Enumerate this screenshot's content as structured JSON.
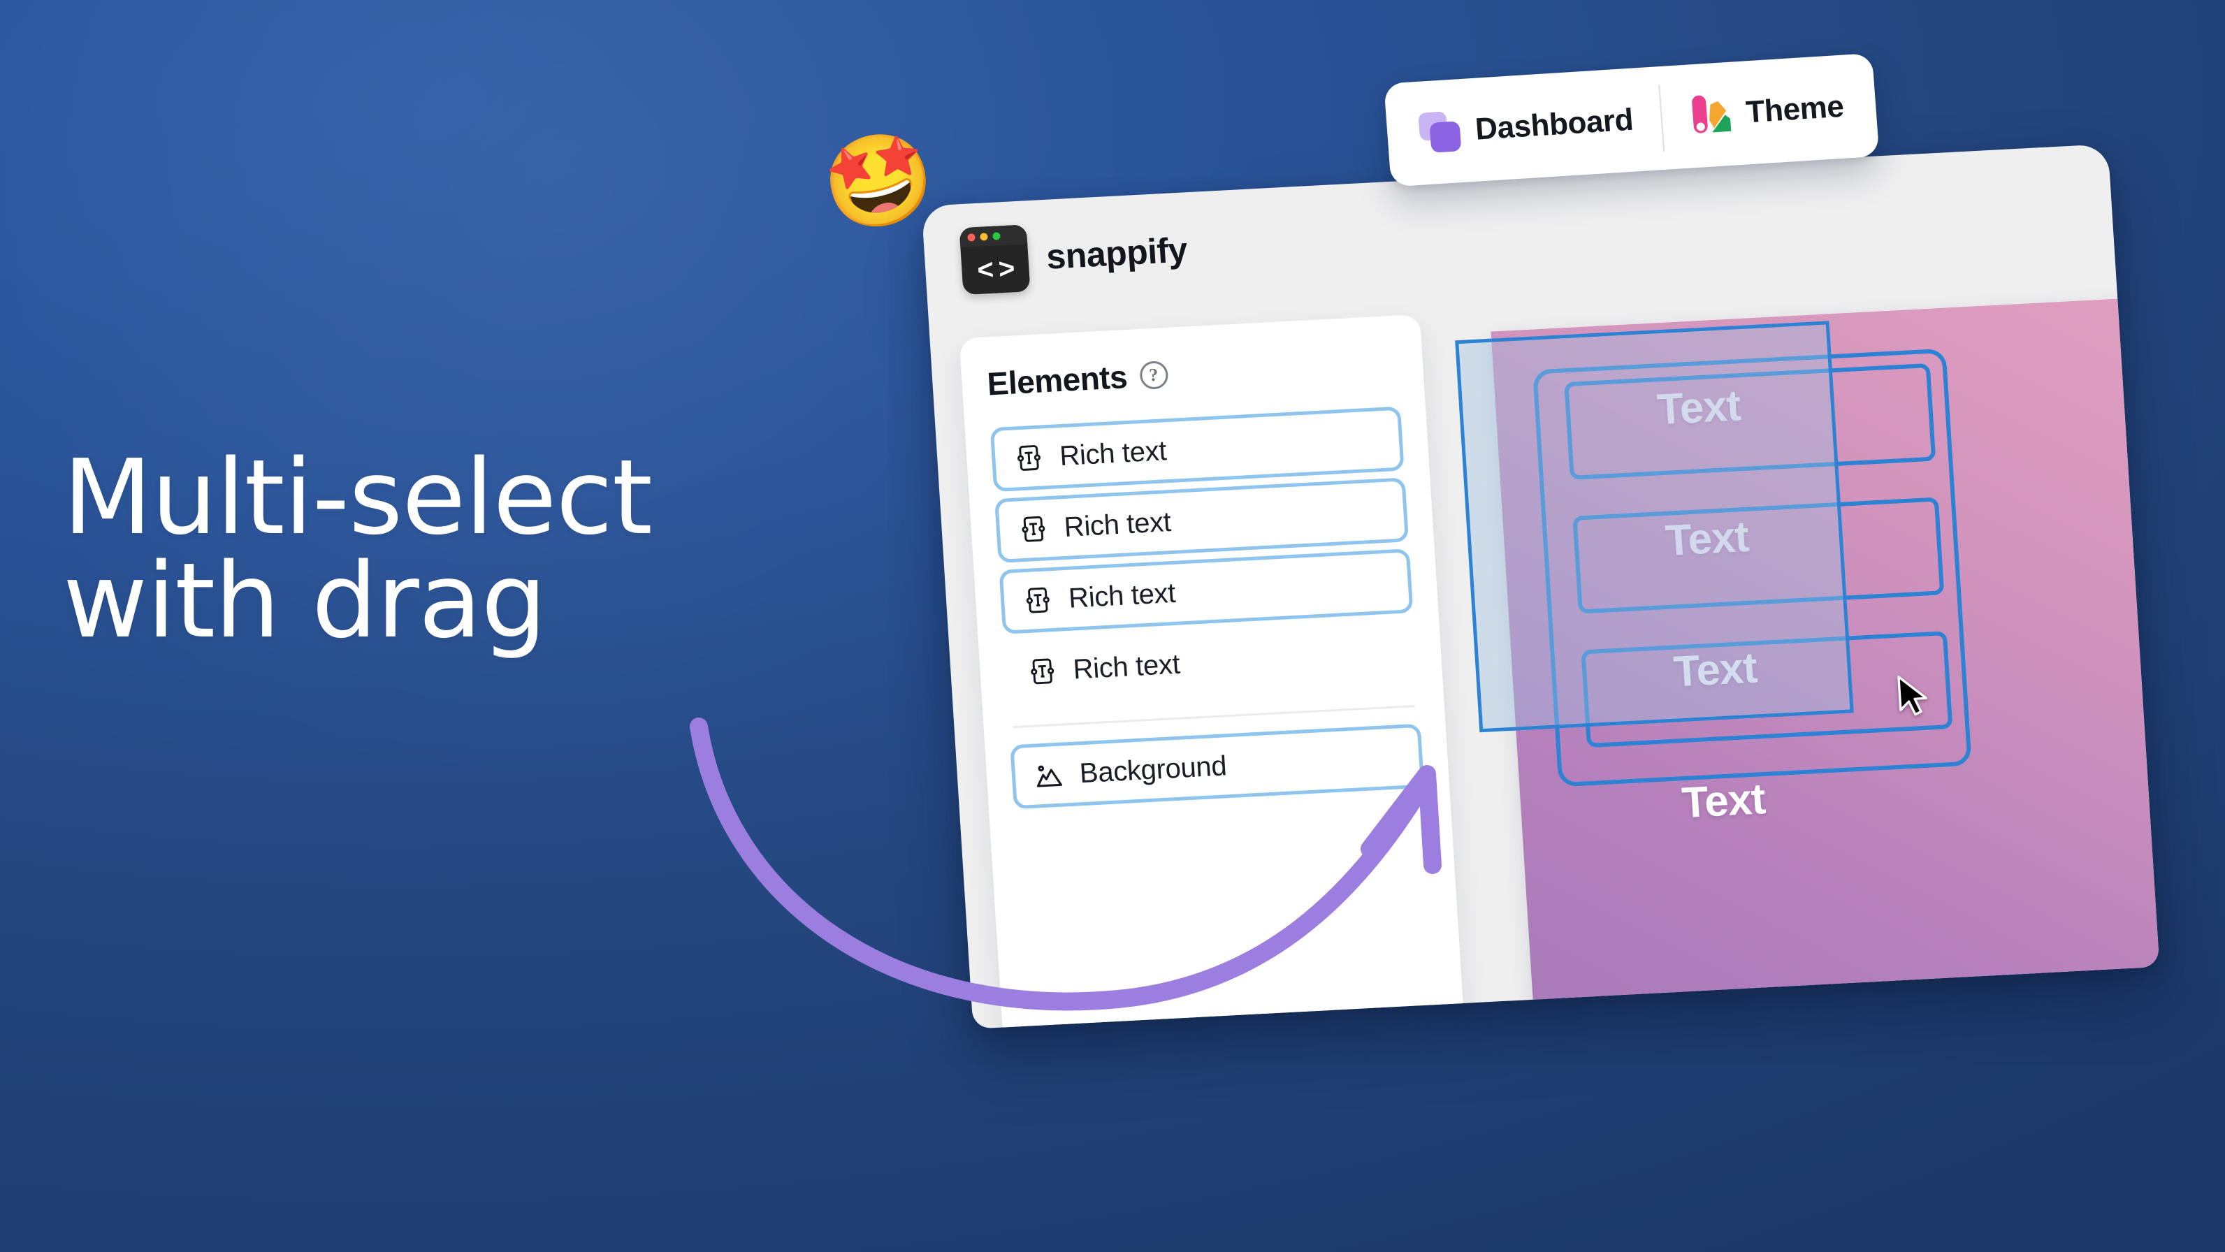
{
  "background": {
    "gradient_from": "#2f5ca6",
    "gradient_to": "#1c3768"
  },
  "headline": {
    "text": "Multi-select\nwith drag",
    "color": "#ffffff"
  },
  "emoji": {
    "glyph": "🤩",
    "name": "star-struck-emoji"
  },
  "app": {
    "brand": {
      "name": "snappify",
      "logo_dots": [
        "#ff5f57",
        "#febc2e",
        "#28c840"
      ],
      "logo_glyph": "< >"
    },
    "nav": {
      "items": [
        {
          "label": "Dashboard",
          "icon": "dashboard-squares-icon"
        },
        {
          "label": "Theme",
          "icon": "color-palette-icon"
        }
      ]
    },
    "elements_panel": {
      "title": "Elements",
      "help_icon": "help-question-icon",
      "help_glyph": "?",
      "items": [
        {
          "label": "Rich text",
          "icon": "rich-text-icon",
          "selected": true
        },
        {
          "label": "Rich text",
          "icon": "rich-text-icon",
          "selected": true
        },
        {
          "label": "Rich text",
          "icon": "rich-text-icon",
          "selected": true
        },
        {
          "label": "Rich text",
          "icon": "rich-text-icon",
          "selected": false
        }
      ],
      "background_item": {
        "label": "Background",
        "icon": "image-mountain-icon",
        "selected": true
      }
    },
    "canvas": {
      "gradient_from": "#e29fc0",
      "gradient_to": "#a87ab8",
      "selection_color": "#2e82d4",
      "marquee_fill": "rgba(157,192,224,0.40)",
      "text_blocks": [
        {
          "label": "Text",
          "selected": true
        },
        {
          "label": "Text",
          "selected": true
        },
        {
          "label": "Text",
          "selected": true
        },
        {
          "label": "Text",
          "selected": false
        }
      ]
    }
  },
  "annotation_arrow": {
    "color": "#9b7ee0",
    "name": "curved-pointer-arrow"
  }
}
